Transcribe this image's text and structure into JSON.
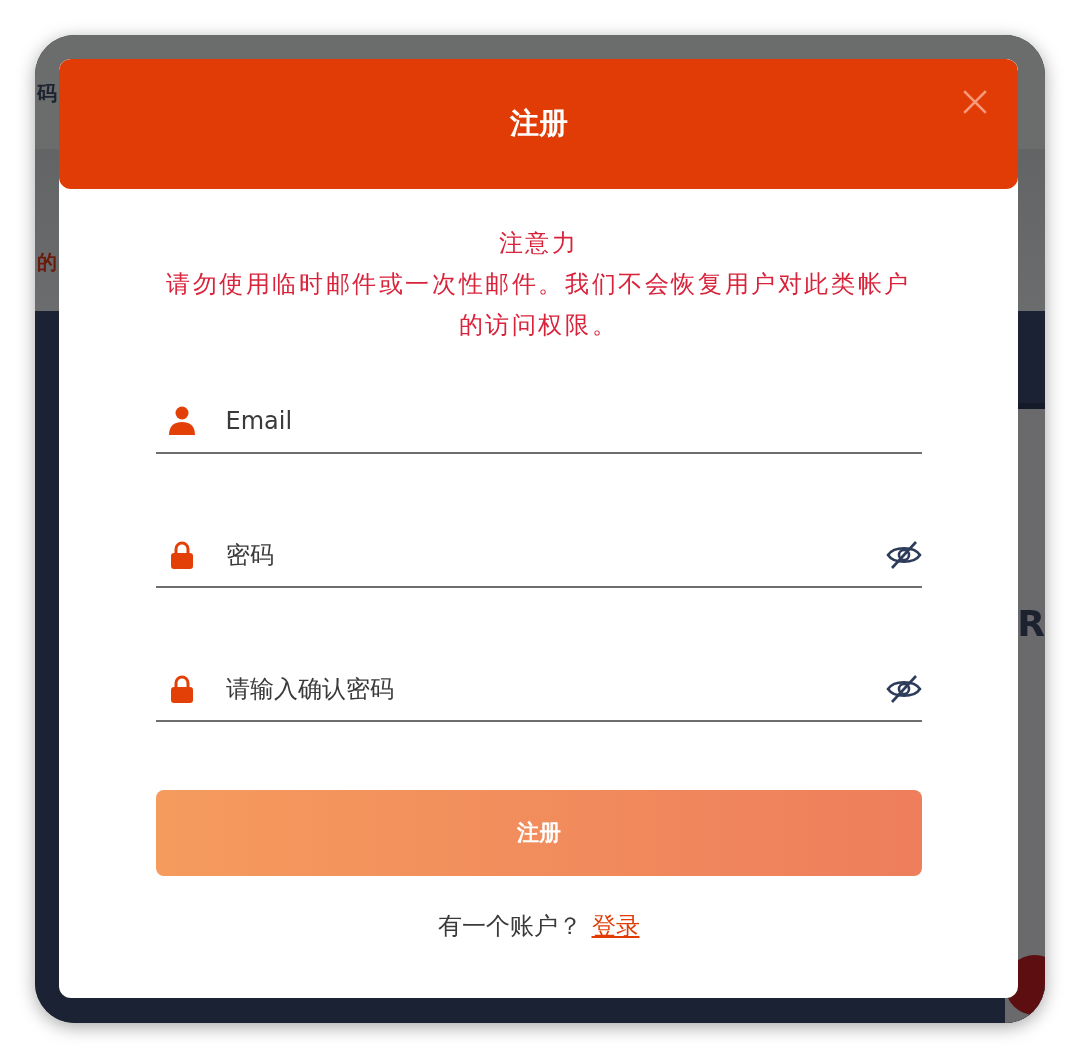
{
  "background": {
    "header_text": "码",
    "hero_subtitle": "的",
    "section_text": "R"
  },
  "modal": {
    "title": "注册",
    "notice": {
      "title": "注意力",
      "message": "请勿使用临时邮件或一次性邮件。我们不会恢复用户对此类帐户的访问权限。"
    },
    "fields": [
      {
        "kind": "email",
        "placeholder": "Email"
      },
      {
        "kind": "password",
        "placeholder": "密码"
      },
      {
        "kind": "password",
        "placeholder": "请输入确认密码"
      }
    ],
    "submit": "注册",
    "footer": {
      "text": "有一个账户？",
      "link": "登录"
    }
  }
}
